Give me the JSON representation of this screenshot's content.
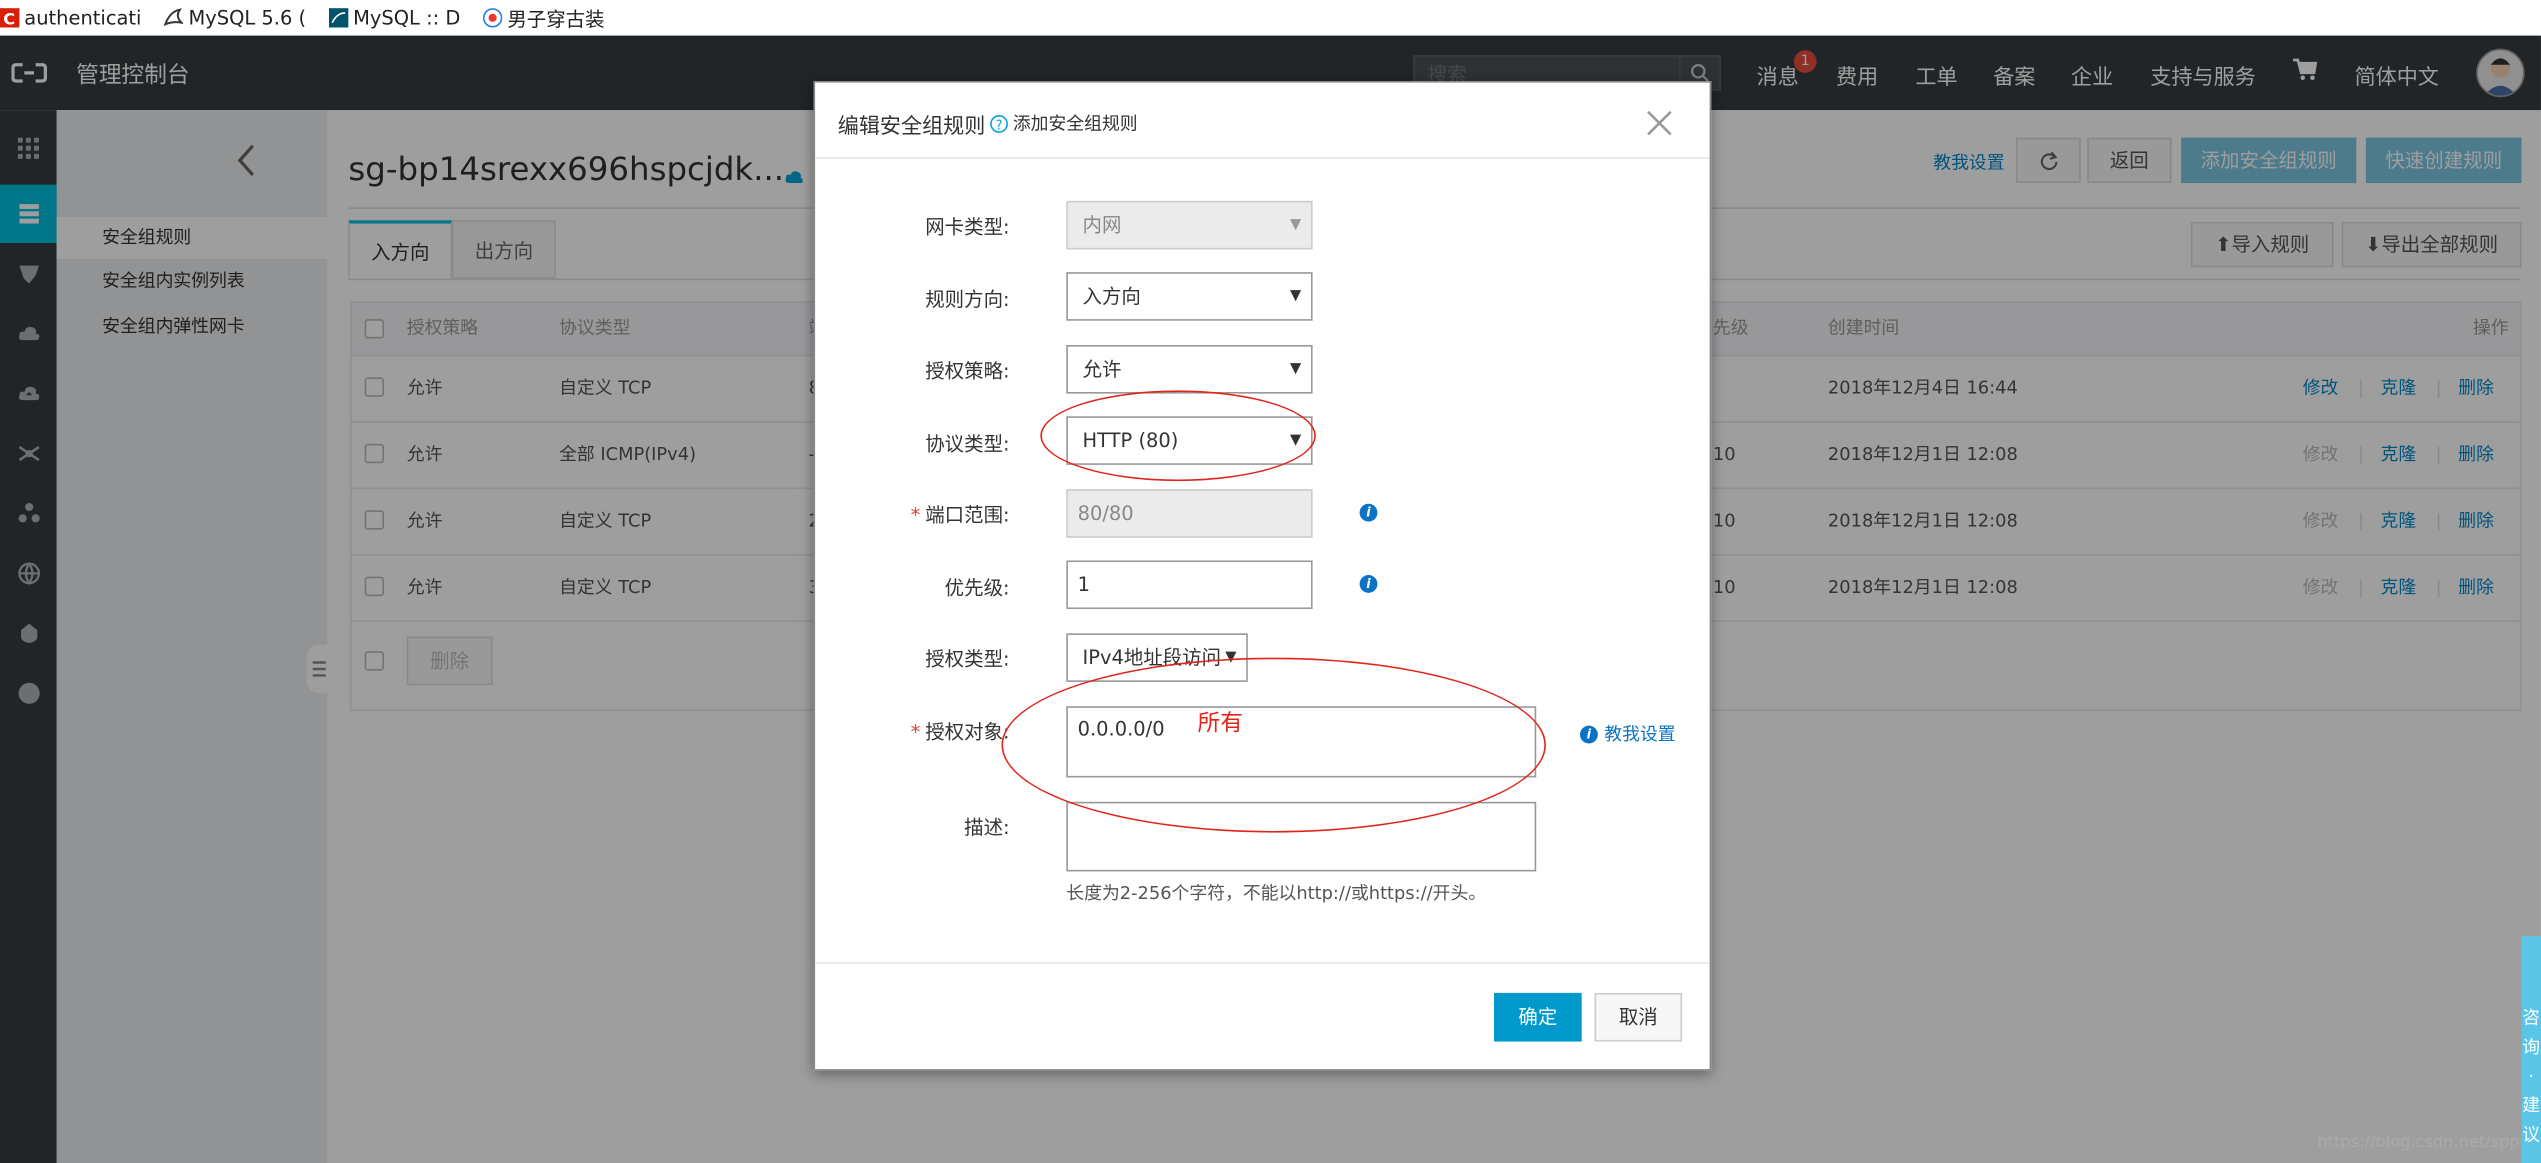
{
  "bookmarks": [
    {
      "label": "authenticati",
      "icon": "red-c-icon"
    },
    {
      "label": "MySQL 5.6 (",
      "icon": "mysql-dolphin-icon"
    },
    {
      "label": "MySQL :: D",
      "icon": "mysql-doc-icon"
    },
    {
      "label": "男子穿古装",
      "icon": "baidu-icon"
    }
  ],
  "topnav": {
    "console_title": "管理控制台",
    "search_placeholder": "搜索",
    "messages": "消息",
    "message_badge": "1",
    "items": [
      "费用",
      "工单",
      "备案",
      "企业",
      "支持与服务"
    ],
    "language": "简体中文"
  },
  "sidebar": {
    "items": [
      "安全组规则",
      "安全组内实例列表",
      "安全组内弹性网卡"
    ]
  },
  "main": {
    "title": "sg-bp14srexx696hspcjdk...",
    "teach_link": "教我设置",
    "back_button": "返回",
    "add_rule_button": "添加安全组规则",
    "quick_create_button": "快速创建规则",
    "import_button": "导入规则",
    "export_button": "导出全部规则",
    "tabs": [
      "入方向",
      "出方向"
    ],
    "columns": {
      "policy": "授权策略",
      "protocol": "协议类型",
      "priority": "先级",
      "created": "创建时间",
      "actions": "操作"
    },
    "rows": [
      {
        "policy": "允许",
        "protocol": "自定义 TCP",
        "port_frag": "8",
        "priority": "",
        "created": "2018年12月4日 16:44",
        "edit_enabled": true
      },
      {
        "policy": "允许",
        "protocol": "全部 ICMP(IPv4)",
        "port_frag": "-",
        "priority": "10",
        "created": "2018年12月1日 12:08",
        "edit_enabled": false
      },
      {
        "policy": "允许",
        "protocol": "自定义 TCP",
        "port_frag": "2",
        "priority": "10",
        "created": "2018年12月1日 12:08",
        "edit_enabled": false
      },
      {
        "policy": "允许",
        "protocol": "自定义 TCP",
        "port_frag": "3",
        "priority": "10",
        "created": "2018年12月1日 12:08",
        "edit_enabled": false
      }
    ],
    "action_labels": {
      "edit": "修改",
      "clone": "克隆",
      "delete": "删除"
    },
    "delete_button": "删除"
  },
  "modal": {
    "title": "编辑安全组规则",
    "help_link": "添加安全组规则",
    "fields": {
      "nic_type": {
        "label": "网卡类型:",
        "value": "内网"
      },
      "direction": {
        "label": "规则方向:",
        "value": "入方向"
      },
      "auth_policy": {
        "label": "授权策略:",
        "value": "允许"
      },
      "protocol": {
        "label": "协议类型:",
        "value": "HTTP (80)"
      },
      "port_range": {
        "label": "端口范围:",
        "value": "80/80"
      },
      "priority": {
        "label": "优先级:",
        "value": "1"
      },
      "auth_type": {
        "label": "授权类型:",
        "value": "IPv4地址段访问"
      },
      "auth_object": {
        "label": "授权对象:",
        "value": "0.0.0.0/0"
      },
      "description": {
        "label": "描述:",
        "value": ""
      }
    },
    "teach_link": "教我设置",
    "hint": "长度为2-256个字符，不能以http://或https://开头。",
    "confirm": "确定",
    "cancel": "取消"
  },
  "annotation": {
    "text": "所有"
  },
  "watermark": "https://blog.csdn.net/sppiu_m",
  "colors": {
    "nav_bg": "#373d41",
    "accent": "#00c1de",
    "primary_button": "#0099cc",
    "annotation_red": "#e1251b"
  }
}
